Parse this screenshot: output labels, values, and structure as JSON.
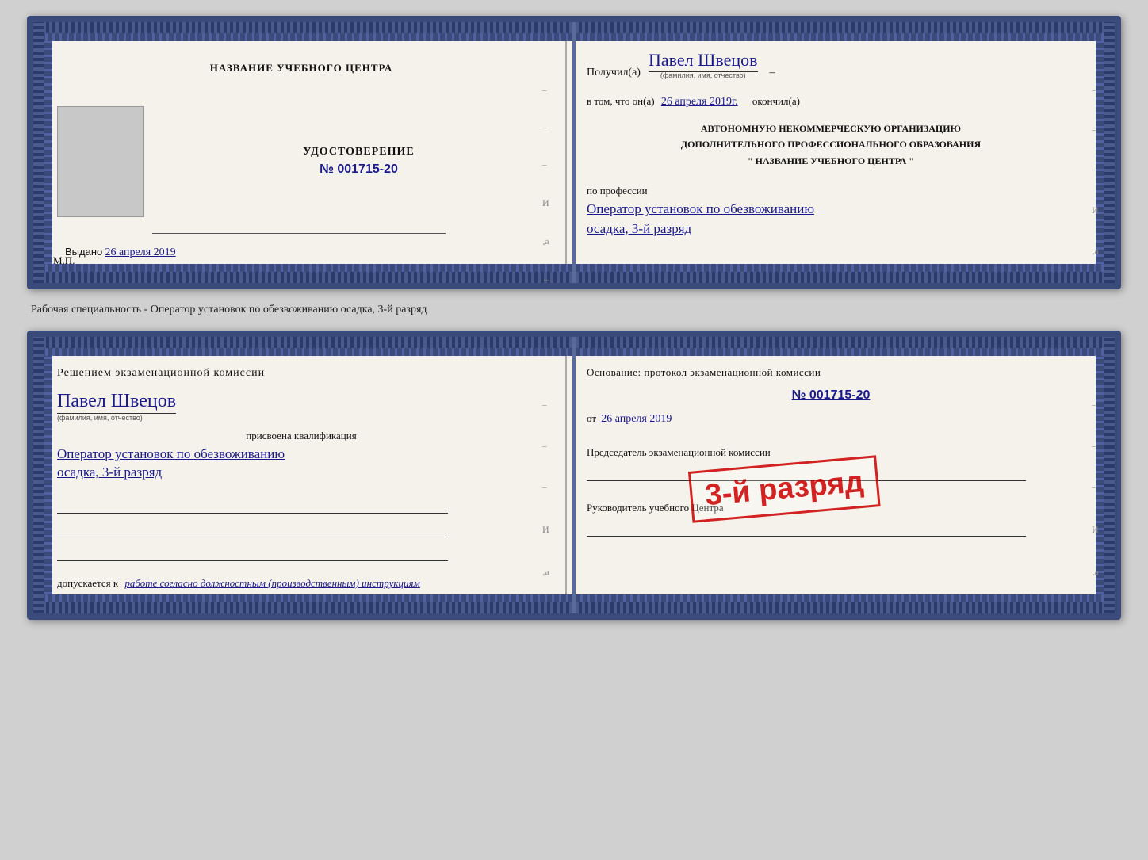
{
  "spread1": {
    "left": {
      "center_title": "НАЗВАНИЕ УЧЕБНОГО ЦЕНТРА",
      "cert_label": "УДОСТОВЕРЕНИЕ",
      "cert_number": "№ 001715-20",
      "issued_label": "Выдано",
      "issued_date": "26 апреля 2019",
      "mp_label": "М.П."
    },
    "right": {
      "received_label": "Получил(а)",
      "recipient_name": "Павел Швецов",
      "fio_hint": "(фамилия, имя, отчество)",
      "cert_text_prefix": "в том, что он(а)",
      "date_handwritten": "26 апреля 2019г.",
      "cert_text_suffix": "окончил(а)",
      "org_line1": "АВТОНОМНУЮ НЕКОММЕРЧЕСКУЮ ОРГАНИЗАЦИЮ",
      "org_line2": "ДОПОЛНИТЕЛЬНОГО ПРОФЕССИОНАЛЬНОГО ОБРАЗОВАНИЯ",
      "org_line3": "\" НАЗВАНИЕ УЧЕБНОГО ЦЕНТРА \"",
      "profession_label": "по профессии",
      "profession_value": "Оператор установок по обезвоживанию",
      "profession_sub": "осадка, 3-й разряд"
    }
  },
  "caption": {
    "text": "Рабочая специальность - Оператор установок по обезвоживанию осадка, 3-й разряд"
  },
  "spread2": {
    "left": {
      "decision_title": "Решением экзаменационной комиссии",
      "person_name": "Павел Швецов",
      "fio_hint": "(фамилия, имя, отчество)",
      "qualification_label": "присвоена квалификация",
      "qualification_value": "Оператор установок по обезвоживанию",
      "qualification_sub": "осадка, 3-й разряд",
      "allow_label": "допускается к",
      "allow_value": "работе согласно должностным (производственным) инструкциям"
    },
    "right": {
      "basis_title": "Основание: протокол экзаменационной комиссии",
      "protocol_number": "№ 001715-20",
      "date_prefix": "от",
      "date_value": "26 апреля 2019",
      "chairman_label": "Председатель экзаменационной комиссии",
      "director_label": "Руководитель учебного Центра"
    },
    "stamp": {
      "text": "3-й разряд"
    }
  }
}
